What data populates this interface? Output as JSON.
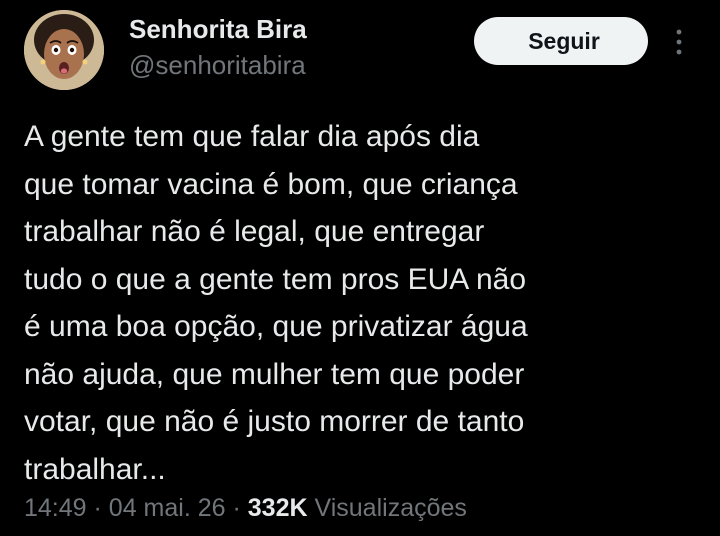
{
  "author": {
    "display_name": "Senhorita Bira",
    "handle": "@senhoritabira",
    "avatar_icon": "profile-photo"
  },
  "follow_button": {
    "label": "Seguir"
  },
  "more_menu": {
    "icon": "more-vertical-icon"
  },
  "tweet": {
    "lines": [
      "A gente tem que falar dia após dia",
      "que tomar vacina é bom, que criança",
      "trabalhar não é legal, que entregar",
      "tudo o que a gente tem pros EUA não",
      "é uma boa opção, que privatizar água",
      "não ajuda, que mulher tem que poder",
      "votar, que não é justo morrer de tanto",
      "trabalhar..."
    ]
  },
  "meta": {
    "time": "14:49",
    "separator": "·",
    "date": "04 mai. 26",
    "views_count": "332K",
    "views_label": "Visualizações"
  },
  "colors": {
    "background": "#000000",
    "primary_text": "#e7e9ea",
    "secondary_text": "#71767b",
    "button_bg": "#eff3f4",
    "button_text": "#0f1419"
  }
}
